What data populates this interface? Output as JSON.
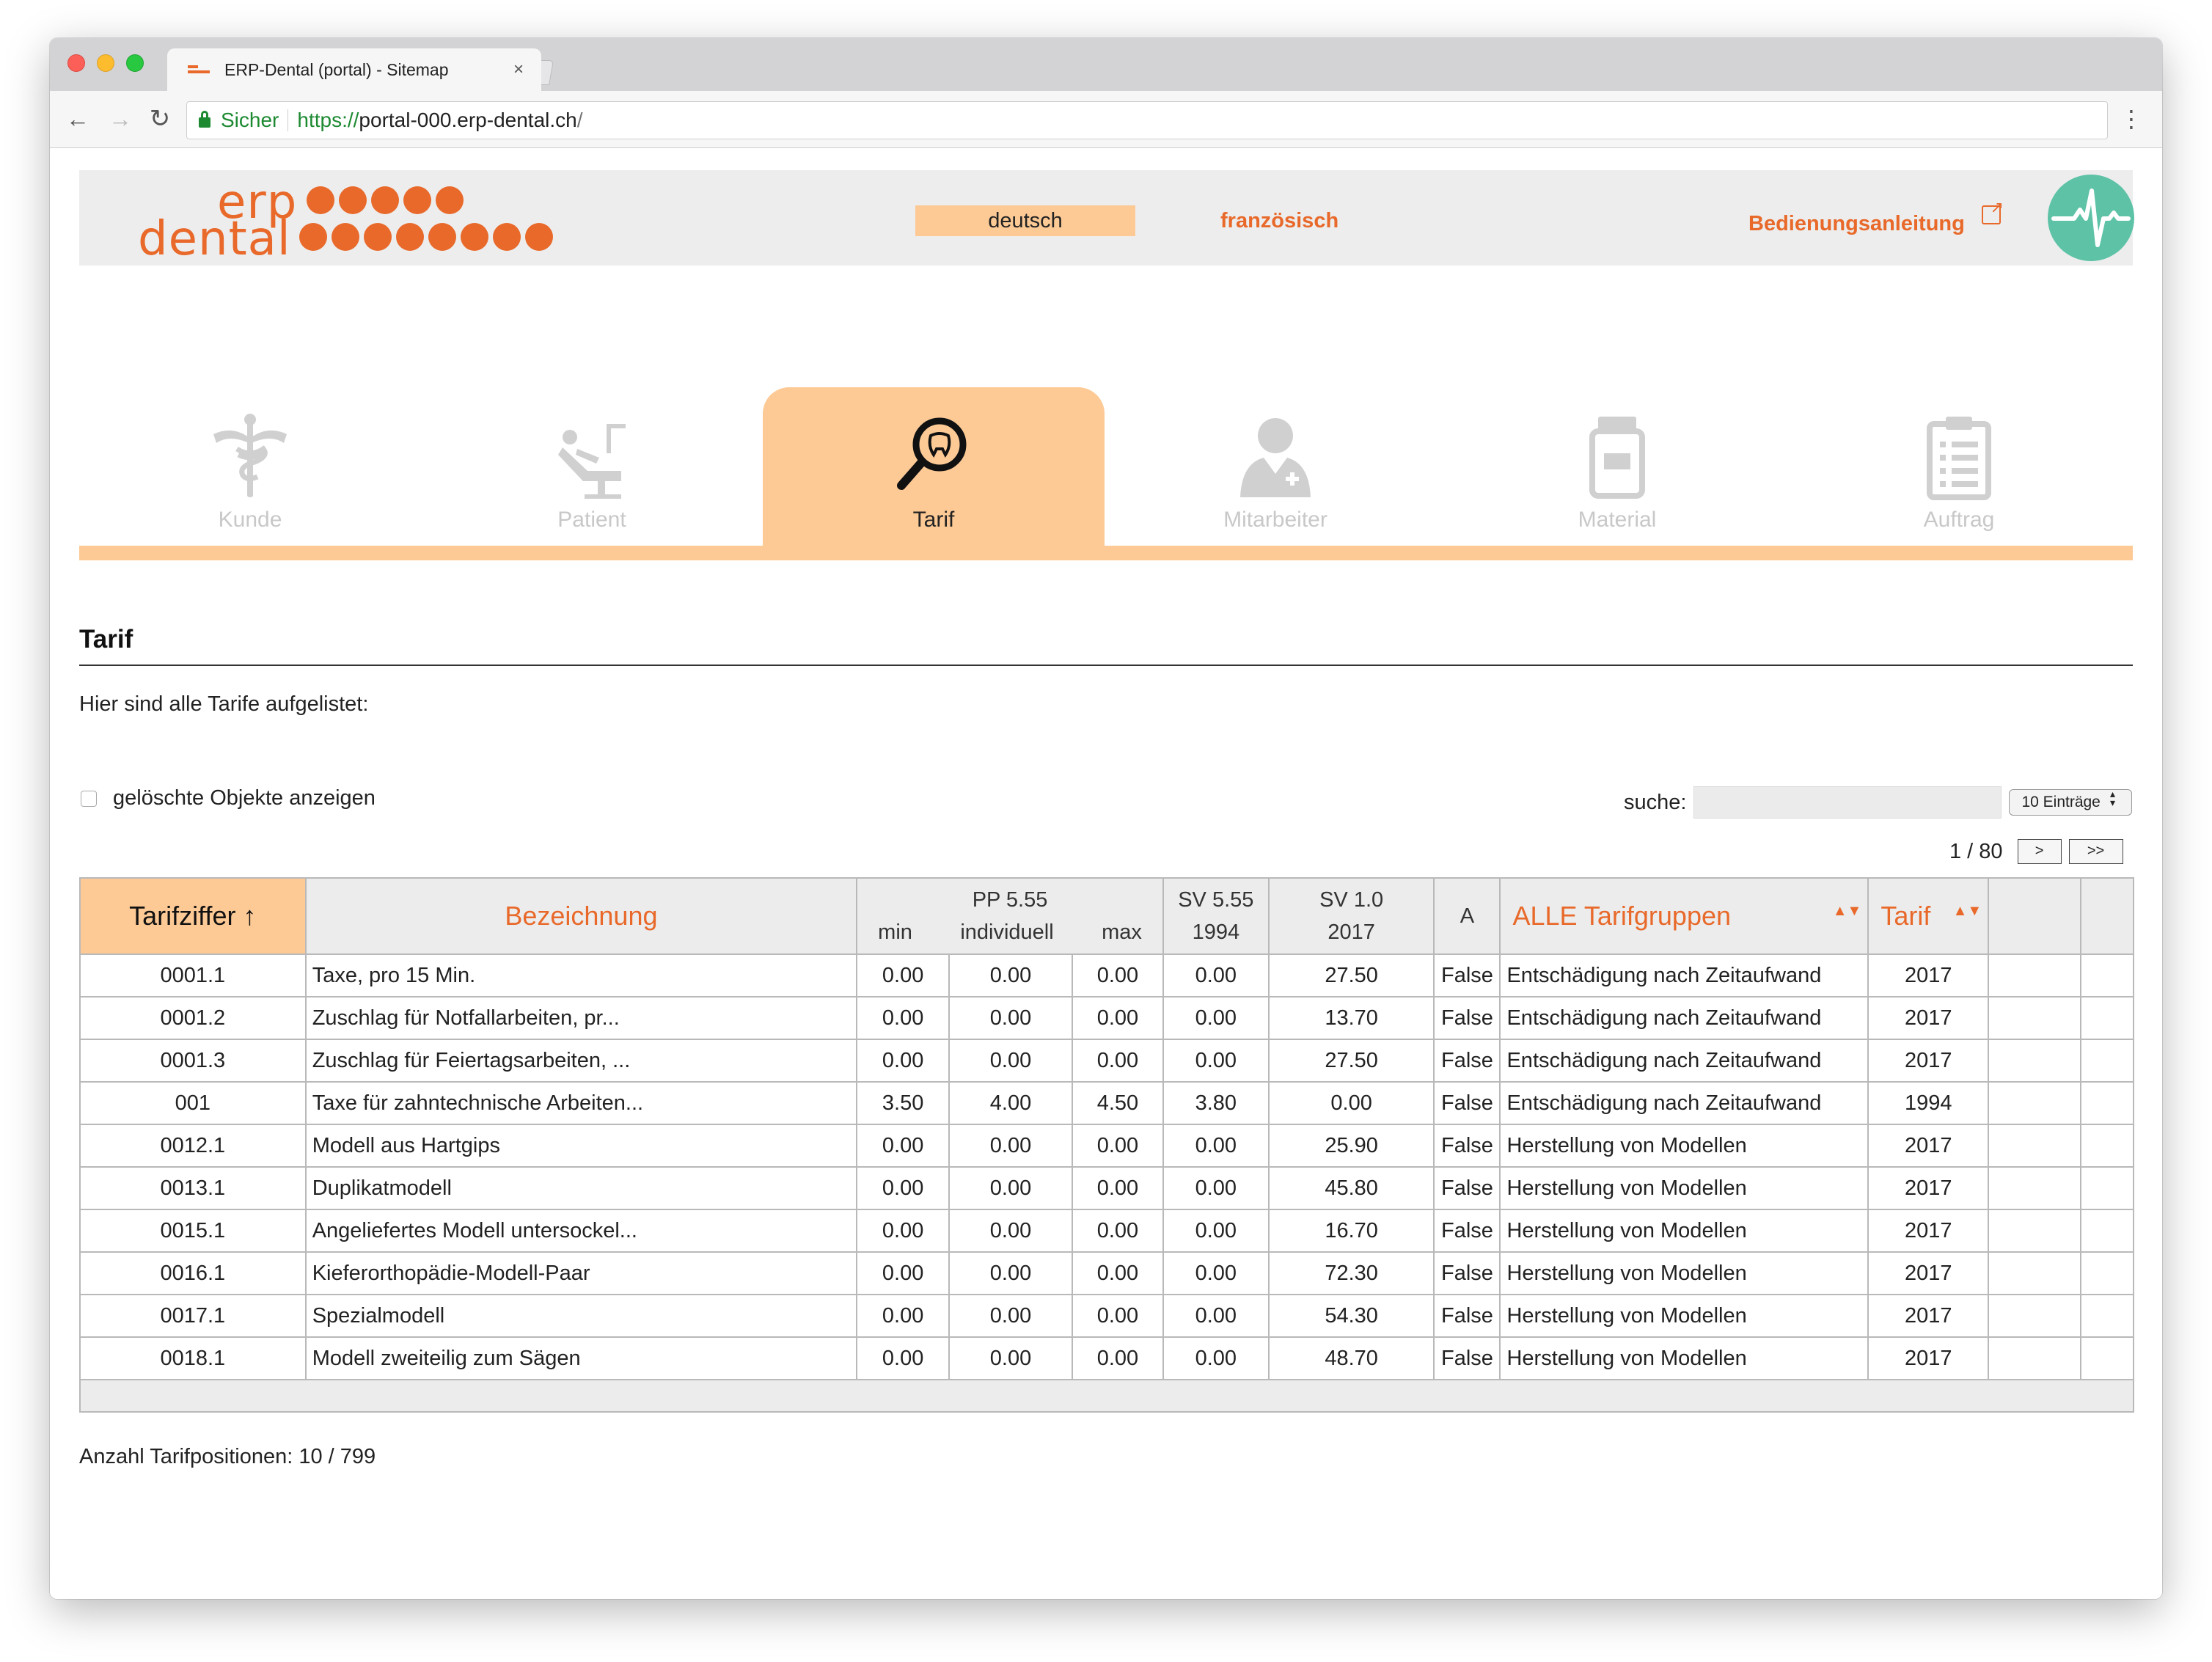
{
  "browser": {
    "tab_title": "ERP-Dental (portal) - Sitemap",
    "tab_close": "×",
    "back": "←",
    "forward": "→",
    "reload": "↻",
    "secure_label": "Sicher",
    "url_scheme": "https://",
    "url_host": "portal-000.erp-dental.ch",
    "url_rest": "/",
    "menu": "⋮"
  },
  "header": {
    "logo_line1": "erp",
    "logo_line2": "dental",
    "lang_active": "deutsch",
    "lang_other": "französisch",
    "manual": "Bedienungsanleitung",
    "brand_color": "#e8692a",
    "accent_color": "#fdca96"
  },
  "modules": [
    {
      "label": "Kunde",
      "icon": "caduceus-icon",
      "active": false
    },
    {
      "label": "Patient",
      "icon": "dental-chair-icon",
      "active": false
    },
    {
      "label": "Tarif",
      "icon": "tooth-magnifier-icon",
      "active": true
    },
    {
      "label": "Mitarbeiter",
      "icon": "doctor-icon",
      "active": false
    },
    {
      "label": "Material",
      "icon": "material-jar-icon",
      "active": false
    },
    {
      "label": "Auftrag",
      "icon": "clipboard-icon",
      "active": false
    }
  ],
  "section": {
    "title": "Tarif",
    "intro": "Hier sind alle Tarife aufgelistet:"
  },
  "filters": {
    "deleted_label": "gelöschte Objekte anzeigen",
    "search_label": "suche:",
    "search_value": "",
    "entries": "10 Einträge"
  },
  "pager": {
    "page": "1 / 80",
    "next": ">",
    "last": ">>"
  },
  "table": {
    "headers": {
      "tarifziffer": "Tarifziffer ↑",
      "bezeichnung": "Bezeichnung",
      "pp_group": "PP 5.55",
      "pp_min": "min",
      "pp_ind": "individuell",
      "pp_max": "max",
      "sv555_a": "SV 5.55",
      "sv555_b": "1994",
      "sv10_a": "SV 1.0",
      "sv10_b": "2017",
      "a": "A",
      "gruppen": "ALLE Tarifgruppen",
      "tarif": "Tarif",
      "sort_arrows": "▲▼"
    },
    "rows": [
      {
        "ziffer": "0001.1",
        "bez": "Taxe, pro 15 Min.",
        "min": "0.00",
        "ind": "0.00",
        "max": "0.00",
        "sv555": "0.00",
        "sv10": "27.50",
        "a": "False",
        "gruppe": "Entschädigung nach Zeitaufwand",
        "tarif": "2017"
      },
      {
        "ziffer": "0001.2",
        "bez": "Zuschlag für Notfallarbeiten, pr...",
        "min": "0.00",
        "ind": "0.00",
        "max": "0.00",
        "sv555": "0.00",
        "sv10": "13.70",
        "a": "False",
        "gruppe": "Entschädigung nach Zeitaufwand",
        "tarif": "2017"
      },
      {
        "ziffer": "0001.3",
        "bez": "Zuschlag für Feiertagsarbeiten, ...",
        "min": "0.00",
        "ind": "0.00",
        "max": "0.00",
        "sv555": "0.00",
        "sv10": "27.50",
        "a": "False",
        "gruppe": "Entschädigung nach Zeitaufwand",
        "tarif": "2017"
      },
      {
        "ziffer": "001",
        "bez": "Taxe für zahntechnische Arbeiten...",
        "min": "3.50",
        "ind": "4.00",
        "max": "4.50",
        "sv555": "3.80",
        "sv10": "0.00",
        "a": "False",
        "gruppe": "Entschädigung nach Zeitaufwand",
        "tarif": "1994"
      },
      {
        "ziffer": "0012.1",
        "bez": "Modell aus Hartgips",
        "min": "0.00",
        "ind": "0.00",
        "max": "0.00",
        "sv555": "0.00",
        "sv10": "25.90",
        "a": "False",
        "gruppe": "Herstellung von Modellen",
        "tarif": "2017"
      },
      {
        "ziffer": "0013.1",
        "bez": "Duplikatmodell",
        "min": "0.00",
        "ind": "0.00",
        "max": "0.00",
        "sv555": "0.00",
        "sv10": "45.80",
        "a": "False",
        "gruppe": "Herstellung von Modellen",
        "tarif": "2017"
      },
      {
        "ziffer": "0015.1",
        "bez": "Angeliefertes Modell untersockel...",
        "min": "0.00",
        "ind": "0.00",
        "max": "0.00",
        "sv555": "0.00",
        "sv10": "16.70",
        "a": "False",
        "gruppe": "Herstellung von Modellen",
        "tarif": "2017"
      },
      {
        "ziffer": "0016.1",
        "bez": "Kieferorthopädie-Modell-Paar",
        "min": "0.00",
        "ind": "0.00",
        "max": "0.00",
        "sv555": "0.00",
        "sv10": "72.30",
        "a": "False",
        "gruppe": "Herstellung von Modellen",
        "tarif": "2017"
      },
      {
        "ziffer": "0017.1",
        "bez": "Spezialmodell",
        "min": "0.00",
        "ind": "0.00",
        "max": "0.00",
        "sv555": "0.00",
        "sv10": "54.30",
        "a": "False",
        "gruppe": "Herstellung von Modellen",
        "tarif": "2017"
      },
      {
        "ziffer": "0018.1",
        "bez": "Modell zweiteilig zum Sägen",
        "min": "0.00",
        "ind": "0.00",
        "max": "0.00",
        "sv555": "0.00",
        "sv10": "48.70",
        "a": "False",
        "gruppe": "Herstellung von Modellen",
        "tarif": "2017"
      }
    ]
  },
  "footer": {
    "count": "Anzahl Tarifpositionen: 10 / 799"
  }
}
